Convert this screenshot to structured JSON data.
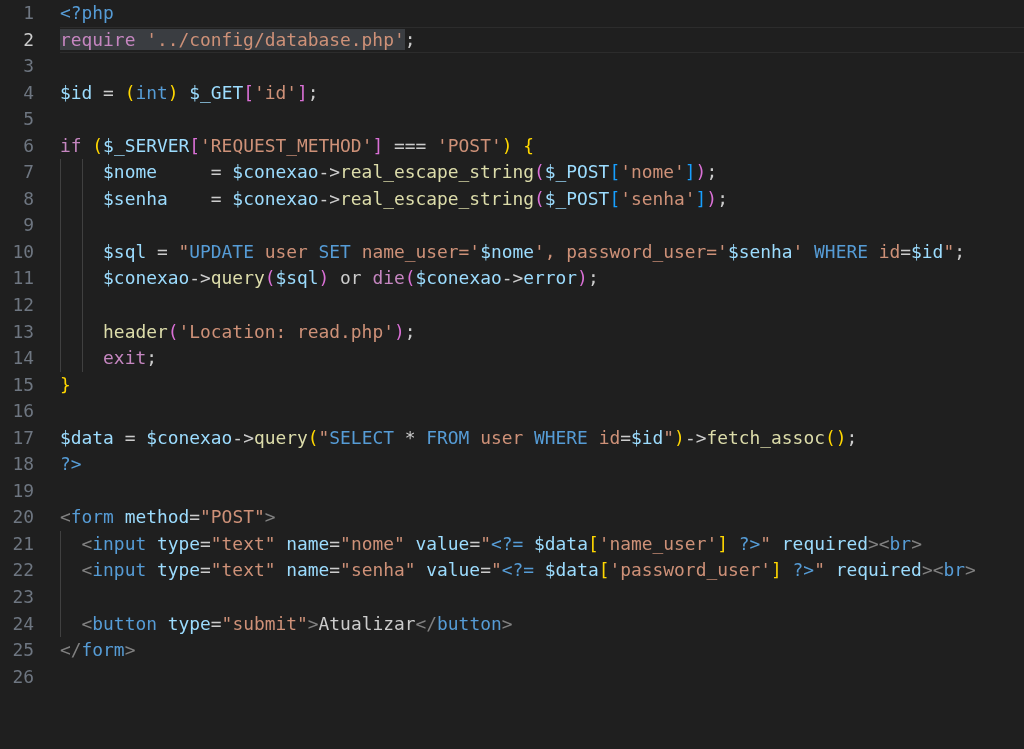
{
  "editor": {
    "lines": [
      {
        "number": "1",
        "current": false,
        "tokens": [
          {
            "kind": "kw",
            "text": "<?php"
          }
        ]
      },
      {
        "number": "2",
        "current": true,
        "selected": [
          {
            "kind": "ctrl",
            "text": "require"
          },
          {
            "kind": "str",
            "text": " '../config/database.php'"
          }
        ],
        "tokens": [
          {
            "kind": "plain",
            "text": ";"
          }
        ]
      },
      {
        "number": "3",
        "current": false
      },
      {
        "number": "4",
        "current": false,
        "tokens": [
          {
            "kind": "var",
            "text": "$id"
          },
          {
            "kind": "plain",
            "text": " = "
          },
          {
            "kind": "b1",
            "text": "("
          },
          {
            "kind": "kw",
            "text": "int"
          },
          {
            "kind": "b1",
            "text": ") "
          },
          {
            "kind": "var",
            "text": "$_GET"
          },
          {
            "kind": "b2",
            "text": "["
          },
          {
            "kind": "str",
            "text": "'id'"
          },
          {
            "kind": "b2",
            "text": "]"
          },
          {
            "kind": "plain",
            "text": ";"
          }
        ]
      },
      {
        "number": "5",
        "current": false
      },
      {
        "number": "6",
        "current": false,
        "tokens": [
          {
            "kind": "ctrl",
            "text": "if "
          },
          {
            "kind": "b1",
            "text": "("
          },
          {
            "kind": "var",
            "text": "$_SERVER"
          },
          {
            "kind": "b2",
            "text": "["
          },
          {
            "kind": "str",
            "text": "'REQUEST_METHOD'"
          },
          {
            "kind": "b2",
            "text": "]"
          },
          {
            "kind": "plain",
            "text": " === "
          },
          {
            "kind": "str",
            "text": "'POST'"
          },
          {
            "kind": "b1",
            "text": ") {"
          }
        ]
      },
      {
        "number": "7",
        "current": false,
        "tokens": [
          {
            "kind": "var",
            "text": "    $nome"
          },
          {
            "kind": "plain",
            "text": "     = "
          },
          {
            "kind": "var",
            "text": "$conexao"
          },
          {
            "kind": "plain",
            "text": "->"
          },
          {
            "kind": "fn",
            "text": "real_escape_string"
          },
          {
            "kind": "b2",
            "text": "("
          },
          {
            "kind": "var",
            "text": "$_POST"
          },
          {
            "kind": "b3",
            "text": "["
          },
          {
            "kind": "str",
            "text": "'nome'"
          },
          {
            "kind": "b3",
            "text": "]"
          },
          {
            "kind": "b2",
            "text": ")"
          },
          {
            "kind": "plain",
            "text": ";"
          }
        ]
      },
      {
        "number": "8",
        "current": false,
        "tokens": [
          {
            "kind": "var",
            "text": "    $senha"
          },
          {
            "kind": "plain",
            "text": "    = "
          },
          {
            "kind": "var",
            "text": "$conexao"
          },
          {
            "kind": "plain",
            "text": "->"
          },
          {
            "kind": "fn",
            "text": "real_escape_string"
          },
          {
            "kind": "b2",
            "text": "("
          },
          {
            "kind": "var",
            "text": "$_POST"
          },
          {
            "kind": "b3",
            "text": "["
          },
          {
            "kind": "str",
            "text": "'senha'"
          },
          {
            "kind": "b3",
            "text": "]"
          },
          {
            "kind": "b2",
            "text": ")"
          },
          {
            "kind": "plain",
            "text": ";"
          }
        ]
      },
      {
        "number": "9",
        "current": false
      },
      {
        "number": "10",
        "current": false,
        "tokens": [
          {
            "kind": "var",
            "text": "    $sql"
          },
          {
            "kind": "plain",
            "text": " = "
          },
          {
            "kind": "str",
            "text": "\""
          },
          {
            "kind": "kw",
            "text": "UPDATE"
          },
          {
            "kind": "str",
            "text": " user "
          },
          {
            "kind": "kw",
            "text": "SET"
          },
          {
            "kind": "str",
            "text": " name_user='"
          },
          {
            "kind": "var",
            "text": "$nome"
          },
          {
            "kind": "str",
            "text": "', password_user='"
          },
          {
            "kind": "var",
            "text": "$senha"
          },
          {
            "kind": "str",
            "text": "' "
          },
          {
            "kind": "kw",
            "text": "WHERE"
          },
          {
            "kind": "str",
            "text": " id"
          },
          {
            "kind": "plain",
            "text": "="
          },
          {
            "kind": "var",
            "text": "$id"
          },
          {
            "kind": "str",
            "text": "\""
          },
          {
            "kind": "plain",
            "text": ";"
          }
        ]
      },
      {
        "number": "11",
        "current": false,
        "tokens": [
          {
            "kind": "var",
            "text": "    $conexao"
          },
          {
            "kind": "plain",
            "text": "->"
          },
          {
            "kind": "fn",
            "text": "query"
          },
          {
            "kind": "b2",
            "text": "("
          },
          {
            "kind": "var",
            "text": "$sql"
          },
          {
            "kind": "b2",
            "text": ")"
          },
          {
            "kind": "plain",
            "text": " or "
          },
          {
            "kind": "ctrl",
            "text": "die"
          },
          {
            "kind": "b2",
            "text": "("
          },
          {
            "kind": "var",
            "text": "$conexao"
          },
          {
            "kind": "plain",
            "text": "->"
          },
          {
            "kind": "var",
            "text": "error"
          },
          {
            "kind": "b2",
            "text": ")"
          },
          {
            "kind": "plain",
            "text": ";"
          }
        ]
      },
      {
        "number": "12",
        "current": false
      },
      {
        "number": "13",
        "current": false,
        "tokens": [
          {
            "kind": "fn",
            "text": "    header"
          },
          {
            "kind": "b2",
            "text": "("
          },
          {
            "kind": "str",
            "text": "'Location: read.php'"
          },
          {
            "kind": "b2",
            "text": ")"
          },
          {
            "kind": "plain",
            "text": ";"
          }
        ]
      },
      {
        "number": "14",
        "current": false,
        "tokens": [
          {
            "kind": "ctrl",
            "text": "    exit"
          },
          {
            "kind": "plain",
            "text": ";"
          }
        ]
      },
      {
        "number": "15",
        "current": false,
        "tokens": [
          {
            "kind": "b1",
            "text": "}"
          }
        ]
      },
      {
        "number": "16",
        "current": false
      },
      {
        "number": "17",
        "current": false,
        "tokens": [
          {
            "kind": "var",
            "text": "$data"
          },
          {
            "kind": "plain",
            "text": " = "
          },
          {
            "kind": "var",
            "text": "$conexao"
          },
          {
            "kind": "plain",
            "text": "->"
          },
          {
            "kind": "fn",
            "text": "query"
          },
          {
            "kind": "b1",
            "text": "("
          },
          {
            "kind": "str",
            "text": "\""
          },
          {
            "kind": "kw",
            "text": "SELECT"
          },
          {
            "kind": "plain",
            "text": " * "
          },
          {
            "kind": "kw",
            "text": "FROM"
          },
          {
            "kind": "str",
            "text": " user "
          },
          {
            "kind": "kw",
            "text": "WHERE"
          },
          {
            "kind": "str",
            "text": " id"
          },
          {
            "kind": "plain",
            "text": "="
          },
          {
            "kind": "var",
            "text": "$id"
          },
          {
            "kind": "str",
            "text": "\""
          },
          {
            "kind": "b1",
            "text": ")"
          },
          {
            "kind": "plain",
            "text": "->"
          },
          {
            "kind": "fn",
            "text": "fetch_assoc"
          },
          {
            "kind": "b1",
            "text": "()"
          },
          {
            "kind": "plain",
            "text": ";"
          }
        ]
      },
      {
        "number": "18",
        "current": false,
        "tokens": [
          {
            "kind": "kw",
            "text": "?>"
          }
        ]
      },
      {
        "number": "19",
        "current": false
      },
      {
        "number": "20",
        "current": false,
        "tokens": [
          {
            "kind": "punct",
            "text": "<"
          },
          {
            "kind": "kw",
            "text": "form"
          },
          {
            "kind": "var",
            "text": " method"
          },
          {
            "kind": "plain",
            "text": "="
          },
          {
            "kind": "str",
            "text": "\"POST\""
          },
          {
            "kind": "punct",
            "text": ">"
          }
        ]
      },
      {
        "number": "21",
        "current": false,
        "tokens": [
          {
            "kind": "punct",
            "text": "  <"
          },
          {
            "kind": "kw",
            "text": "input"
          },
          {
            "kind": "var",
            "text": " type"
          },
          {
            "kind": "plain",
            "text": "="
          },
          {
            "kind": "str",
            "text": "\"text\""
          },
          {
            "kind": "var",
            "text": " name"
          },
          {
            "kind": "plain",
            "text": "="
          },
          {
            "kind": "str",
            "text": "\"nome\""
          },
          {
            "kind": "var",
            "text": " value"
          },
          {
            "kind": "plain",
            "text": "="
          },
          {
            "kind": "str",
            "text": "\""
          },
          {
            "kind": "kw",
            "text": "<?="
          },
          {
            "kind": "var",
            "text": " $data"
          },
          {
            "kind": "b1",
            "text": "["
          },
          {
            "kind": "str",
            "text": "'name_user'"
          },
          {
            "kind": "b1",
            "text": "]"
          },
          {
            "kind": "kw",
            "text": " ?>"
          },
          {
            "kind": "str",
            "text": "\""
          },
          {
            "kind": "var",
            "text": " required"
          },
          {
            "kind": "punct",
            "text": "><"
          },
          {
            "kind": "kw",
            "text": "br"
          },
          {
            "kind": "punct",
            "text": ">"
          }
        ]
      },
      {
        "number": "22",
        "current": false,
        "tokens": [
          {
            "kind": "punct",
            "text": "  <"
          },
          {
            "kind": "kw",
            "text": "input"
          },
          {
            "kind": "var",
            "text": " type"
          },
          {
            "kind": "plain",
            "text": "="
          },
          {
            "kind": "str",
            "text": "\"text\""
          },
          {
            "kind": "var",
            "text": " name"
          },
          {
            "kind": "plain",
            "text": "="
          },
          {
            "kind": "str",
            "text": "\"senha\""
          },
          {
            "kind": "var",
            "text": " value"
          },
          {
            "kind": "plain",
            "text": "="
          },
          {
            "kind": "str",
            "text": "\""
          },
          {
            "kind": "kw",
            "text": "<?="
          },
          {
            "kind": "var",
            "text": " $data"
          },
          {
            "kind": "b1",
            "text": "["
          },
          {
            "kind": "str",
            "text": "'password_user'"
          },
          {
            "kind": "b1",
            "text": "]"
          },
          {
            "kind": "kw",
            "text": " ?>"
          },
          {
            "kind": "str",
            "text": "\""
          },
          {
            "kind": "var",
            "text": " required"
          },
          {
            "kind": "punct",
            "text": "><"
          },
          {
            "kind": "kw",
            "text": "br"
          },
          {
            "kind": "punct",
            "text": ">"
          }
        ]
      },
      {
        "number": "23",
        "current": false
      },
      {
        "number": "24",
        "current": false,
        "tokens": [
          {
            "kind": "punct",
            "text": "  <"
          },
          {
            "kind": "kw",
            "text": "button"
          },
          {
            "kind": "var",
            "text": " type"
          },
          {
            "kind": "plain",
            "text": "="
          },
          {
            "kind": "str",
            "text": "\"submit\""
          },
          {
            "kind": "punct",
            "text": ">"
          },
          {
            "kind": "plain",
            "text": "Atualizar"
          },
          {
            "kind": "punct",
            "text": "</"
          },
          {
            "kind": "kw",
            "text": "button"
          },
          {
            "kind": "punct",
            "text": ">"
          }
        ]
      },
      {
        "number": "25",
        "current": false,
        "tokens": [
          {
            "kind": "punct",
            "text": "</"
          },
          {
            "kind": "kw",
            "text": "form"
          },
          {
            "kind": "punct",
            "text": ">"
          }
        ]
      },
      {
        "number": "26",
        "current": false
      }
    ]
  }
}
